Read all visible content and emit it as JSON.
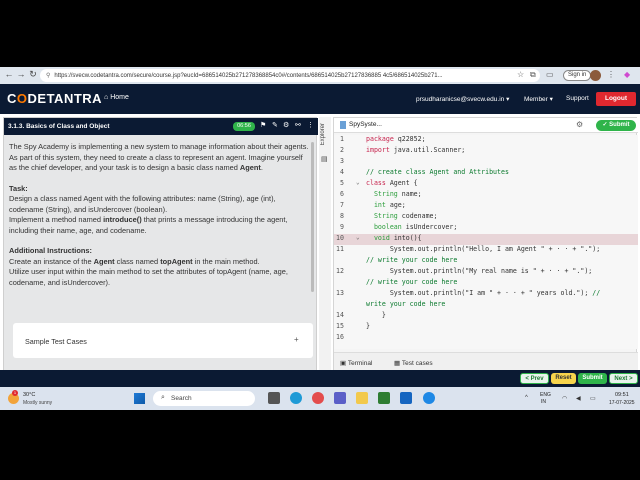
{
  "browser": {
    "url": "https://svecw.codetantra.com/secure/course.jsp?eucId=686514025b271278368854c0#/contents/686514025b27127836885 4c5/686514025b271...",
    "signin_label": "Sign in"
  },
  "header": {
    "logo_left": "C",
    "logo_o": "O",
    "logo_right": "DETANTRA",
    "home_label": "Home",
    "user_email": "prsudharanicse@svecw.edu.in",
    "member_label": "Member",
    "support_label": "Support",
    "logout_label": "Logout"
  },
  "problem": {
    "title": "3.1.3. Basics of Class and Object",
    "timer": "06:56",
    "para1_prefix": "The Spy Academy is implementing a new system to manage information about their agents. As part of this system, they need to create a class to represent an agent. Imagine yourself as the chief developer, and your task is to design a basic class named ",
    "para1_bold": "Agent",
    "para1_suffix": ".",
    "task_heading": "Task:",
    "task_line1": "Design a class named Agent with the following attributes: name (String), age (int), codename (String), and isUndercover (boolean).",
    "task_line2_prefix": "Implement a method named ",
    "task_line2_bold": "introduce()",
    "task_line2_suffix": " that prints a message introducing the agent, including their name, age, and codename.",
    "addl_heading": "Additional Instructions:",
    "addl_line1_prefix": "Create an instance of the ",
    "addl_line1_bold1": "Agent",
    "addl_line1_mid": " class named ",
    "addl_line1_bold2": "topAgent",
    "addl_line1_suffix": " in the main method.",
    "addl_line2": "Utilize user input within the main method to set the attributes of topAgent (name, age, codename, and isUndercover).",
    "sample_tc_label": "Sample Test Cases",
    "sample_tc_toggle": "+"
  },
  "explorer": {
    "label": "Explorer"
  },
  "editor": {
    "file_tab": "SpySyste...",
    "submit_label": "Submit",
    "lines": [
      {
        "n": "1",
        "parts": [
          [
            "kw",
            "package"
          ],
          [
            "st",
            " q22852;"
          ]
        ]
      },
      {
        "n": "2",
        "parts": [
          [
            "kw",
            "import"
          ],
          [
            "st",
            " java.util.Scanner;"
          ]
        ]
      },
      {
        "n": "3",
        "parts": []
      },
      {
        "n": "4",
        "parts": [
          [
            "cm",
            "// create class Agent and Attributes"
          ]
        ]
      },
      {
        "n": "5",
        "parts": [
          [
            "kw",
            "class"
          ],
          [
            "st",
            " Agent {"
          ]
        ]
      },
      {
        "n": "6",
        "parts": [
          [
            "st",
            "  "
          ],
          [
            "ty",
            "String"
          ],
          [
            "st",
            " name;"
          ]
        ]
      },
      {
        "n": "7",
        "parts": [
          [
            "st",
            "  "
          ],
          [
            "ty",
            "int"
          ],
          [
            "st",
            " age;"
          ]
        ]
      },
      {
        "n": "8",
        "parts": [
          [
            "st",
            "  "
          ],
          [
            "ty",
            "String"
          ],
          [
            "st",
            " codename;"
          ]
        ]
      },
      {
        "n": "9",
        "parts": [
          [
            "st",
            "  "
          ],
          [
            "ty",
            "boolean"
          ],
          [
            "st",
            " isUndercover;"
          ]
        ]
      },
      {
        "n": "10",
        "parts": [
          [
            "st",
            "  "
          ],
          [
            "ty",
            "void"
          ],
          [
            "st",
            " into(){"
          ]
        ]
      },
      {
        "n": "11",
        "parts": [
          [
            "st",
            "      System.out.println(\"Hello, I am Agent \" + · · + \".\");"
          ]
        ]
      },
      {
        "n": "",
        "parts": [
          [
            "cm",
            "// write your code here"
          ]
        ]
      },
      {
        "n": "12",
        "parts": [
          [
            "st",
            "      System.out.println(\"My real name is \" + · · + \".\");"
          ]
        ]
      },
      {
        "n": "",
        "parts": [
          [
            "cm",
            "// write your code here"
          ]
        ]
      },
      {
        "n": "13",
        "parts": [
          [
            "st",
            "      System.out.println(\"I am \" + · · + \" years old.\"); "
          ],
          [
            "cm",
            "//"
          ]
        ]
      },
      {
        "n": "",
        "parts": [
          [
            "cm",
            "write your code here"
          ]
        ]
      },
      {
        "n": "14",
        "parts": [
          [
            "st",
            "    }"
          ]
        ]
      },
      {
        "n": "15",
        "parts": [
          [
            "st",
            "}"
          ]
        ]
      },
      {
        "n": "16",
        "parts": []
      }
    ],
    "terminal_label": "Terminal",
    "testcases_label": "Test cases"
  },
  "footer": {
    "prev_label": "< Prev",
    "reset_label": "Reset",
    "submit_label": "Submit",
    "next_label": "Next >"
  },
  "taskbar": {
    "temp": "30°C",
    "condition": "Mostly sunny",
    "badge": "1",
    "search_label": "Search",
    "lang_line1": "ENG",
    "lang_line2": "IN",
    "time": "09:51",
    "date": "17-07-2025"
  }
}
